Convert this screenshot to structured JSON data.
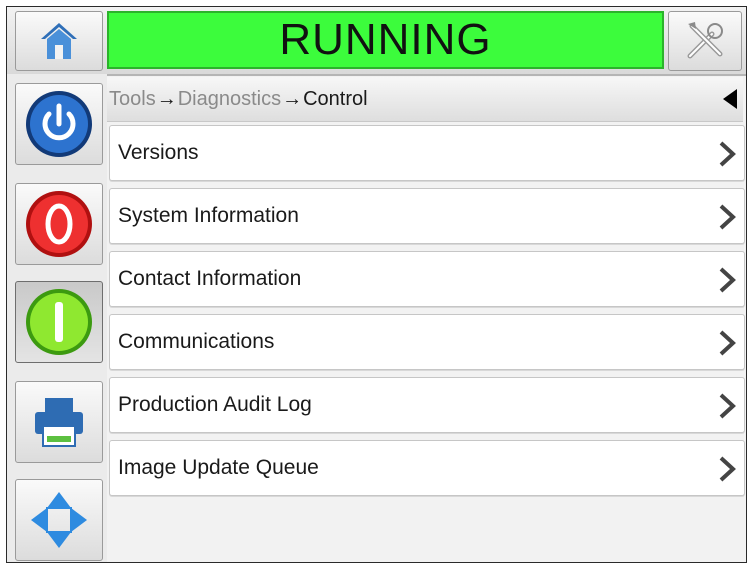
{
  "status": {
    "text": "RUNNING",
    "color": "#3cfc3c"
  },
  "breadcrumb": {
    "items": [
      "Tools",
      "Diagnostics",
      "Control"
    ],
    "separator": "→"
  },
  "sidebar": {
    "buttons": [
      {
        "icon": "power-icon"
      },
      {
        "icon": "stop-icon"
      },
      {
        "icon": "start-icon"
      },
      {
        "icon": "printer-icon"
      },
      {
        "icon": "navigation-arrows-icon"
      }
    ]
  },
  "menu": {
    "items": [
      {
        "label": "Versions"
      },
      {
        "label": "System Information"
      },
      {
        "label": "Contact Information"
      },
      {
        "label": "Communications"
      },
      {
        "label": "Production Audit Log"
      },
      {
        "label": "Image Update Queue"
      }
    ]
  }
}
